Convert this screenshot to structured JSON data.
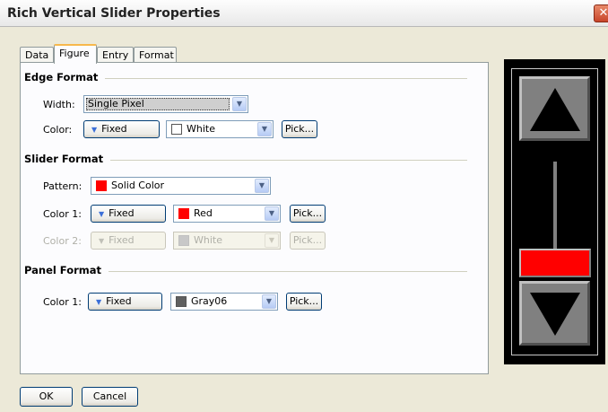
{
  "window": {
    "title": "Rich Vertical Slider Properties",
    "close_glyph": "✕"
  },
  "tabs": [
    {
      "label": "Data",
      "active": false
    },
    {
      "label": "Figure",
      "active": true
    },
    {
      "label": "Entry",
      "active": false
    },
    {
      "label": "Format",
      "active": false
    }
  ],
  "edge_format": {
    "title": "Edge Format",
    "width_label": "Width:",
    "width_value": "Single Pixel",
    "color_label": "Color:",
    "color_mode": "Fixed",
    "color_value": "White",
    "color_swatch": "#ffffff",
    "pick_label": "Pick..."
  },
  "slider_format": {
    "title": "Slider Format",
    "pattern_label": "Pattern:",
    "pattern_value": "Solid Color",
    "pattern_swatch": "#ff0000",
    "color1_label": "Color 1:",
    "color1_mode": "Fixed",
    "color1_value": "Red",
    "color1_swatch": "#ff0000",
    "color1_pick": "Pick...",
    "color2_label": "Color 2:",
    "color2_mode": "Fixed",
    "color2_value": "White",
    "color2_swatch": "#c8c8c8",
    "color2_pick": "Pick...",
    "color2_enabled": false
  },
  "panel_format": {
    "title": "Panel Format",
    "color1_label": "Color 1:",
    "color1_mode": "Fixed",
    "color1_value": "Gray06",
    "color1_swatch": "#606060",
    "color1_pick": "Pick..."
  },
  "footer": {
    "ok_label": "OK",
    "cancel_label": "Cancel"
  },
  "preview": {
    "thumb_color": "#ff0000",
    "button_color": "#808080",
    "background": "#000000"
  }
}
